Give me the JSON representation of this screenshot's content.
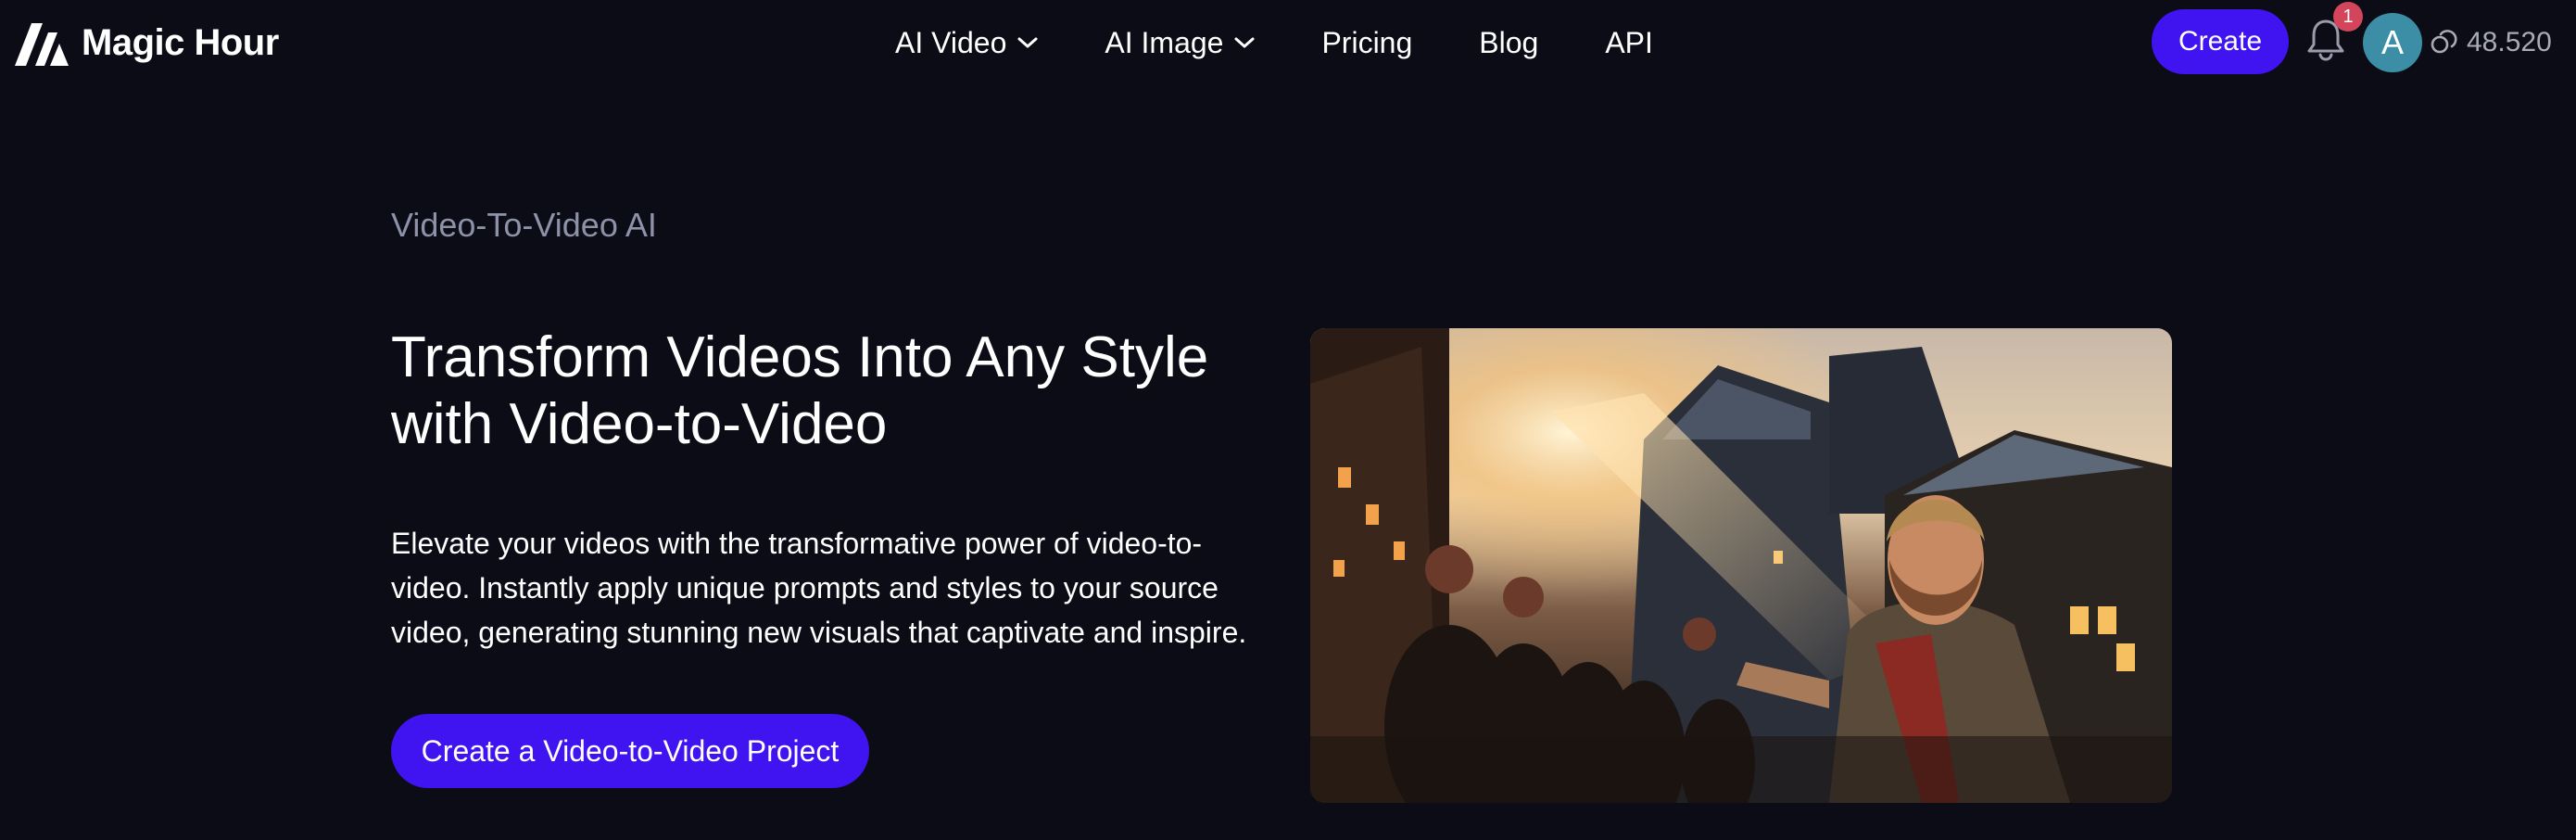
{
  "header": {
    "brand": "Magic Hour",
    "nav": [
      {
        "label": "AI Video",
        "has_dropdown": true
      },
      {
        "label": "AI Image",
        "has_dropdown": true
      },
      {
        "label": "Pricing",
        "has_dropdown": false
      },
      {
        "label": "Blog",
        "has_dropdown": false
      },
      {
        "label": "API",
        "has_dropdown": false
      }
    ],
    "create_label": "Create",
    "notification_count": "1",
    "avatar_initial": "A",
    "credits": "48.520"
  },
  "hero": {
    "eyebrow": "Video-To-Video AI",
    "title": "Transform Videos Into Any Style with Video-to-Video",
    "description": "Elevate your videos with the transformative power of video-to-video. Instantly apply unique prompts and styles to your source video, generating stunning new visuals that captivate and inspire.",
    "cta_label": "Create a Video-to-Video Project"
  },
  "icons": {
    "logo": "magic-hour-logo-icon",
    "dropdown": "chevron-down-icon",
    "notifications": "bell-icon",
    "credits": "coins-icon"
  },
  "colors": {
    "background": "#0c0c16",
    "accent": "#4014f0",
    "badge": "#d2455a",
    "avatar": "#3b8ea5",
    "muted_text": "#8d92a8"
  }
}
